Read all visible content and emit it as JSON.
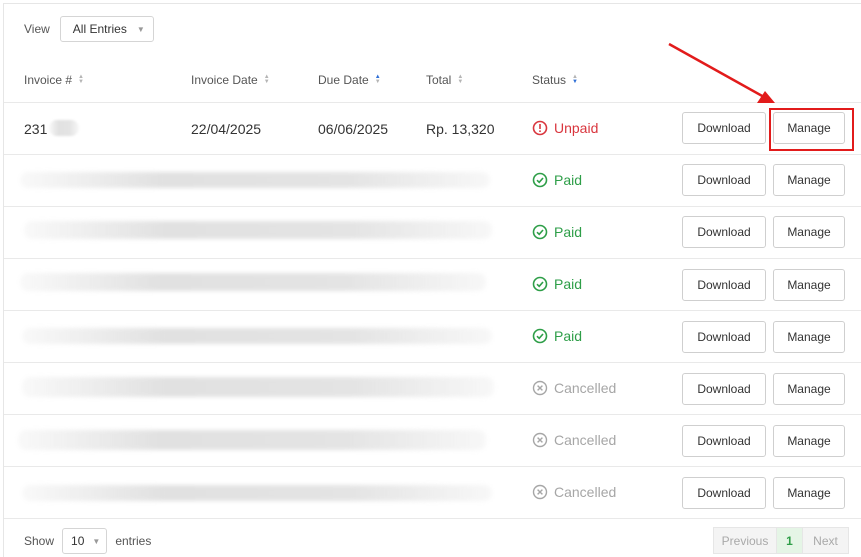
{
  "view": {
    "label": "View",
    "value": "All Entries"
  },
  "columns": {
    "invoice": "Invoice #",
    "invoice_date": "Invoice Date",
    "due_date": "Due Date",
    "total": "Total",
    "status": "Status"
  },
  "rows": [
    {
      "invoice": "231",
      "invoice_date": "22/04/2025",
      "due_date": "06/06/2025",
      "total": "Rp. 13,320",
      "status": "Unpaid"
    },
    {
      "status": "Paid"
    },
    {
      "status": "Paid"
    },
    {
      "status": "Paid"
    },
    {
      "status": "Paid"
    },
    {
      "status": "Cancelled"
    },
    {
      "status": "Cancelled"
    },
    {
      "status": "Cancelled"
    }
  ],
  "buttons": {
    "download": "Download",
    "manage": "Manage"
  },
  "footer": {
    "show": "Show",
    "page_size": "10",
    "entries": "entries"
  },
  "pagination": {
    "previous": "Previous",
    "current": "1",
    "next": "Next"
  },
  "colors": {
    "unpaid": "#d9363e",
    "paid": "#2e9e48",
    "cancelled": "#a6a6a6",
    "sort_active": "#2f6fd6",
    "annotation": "#e21b1b"
  }
}
